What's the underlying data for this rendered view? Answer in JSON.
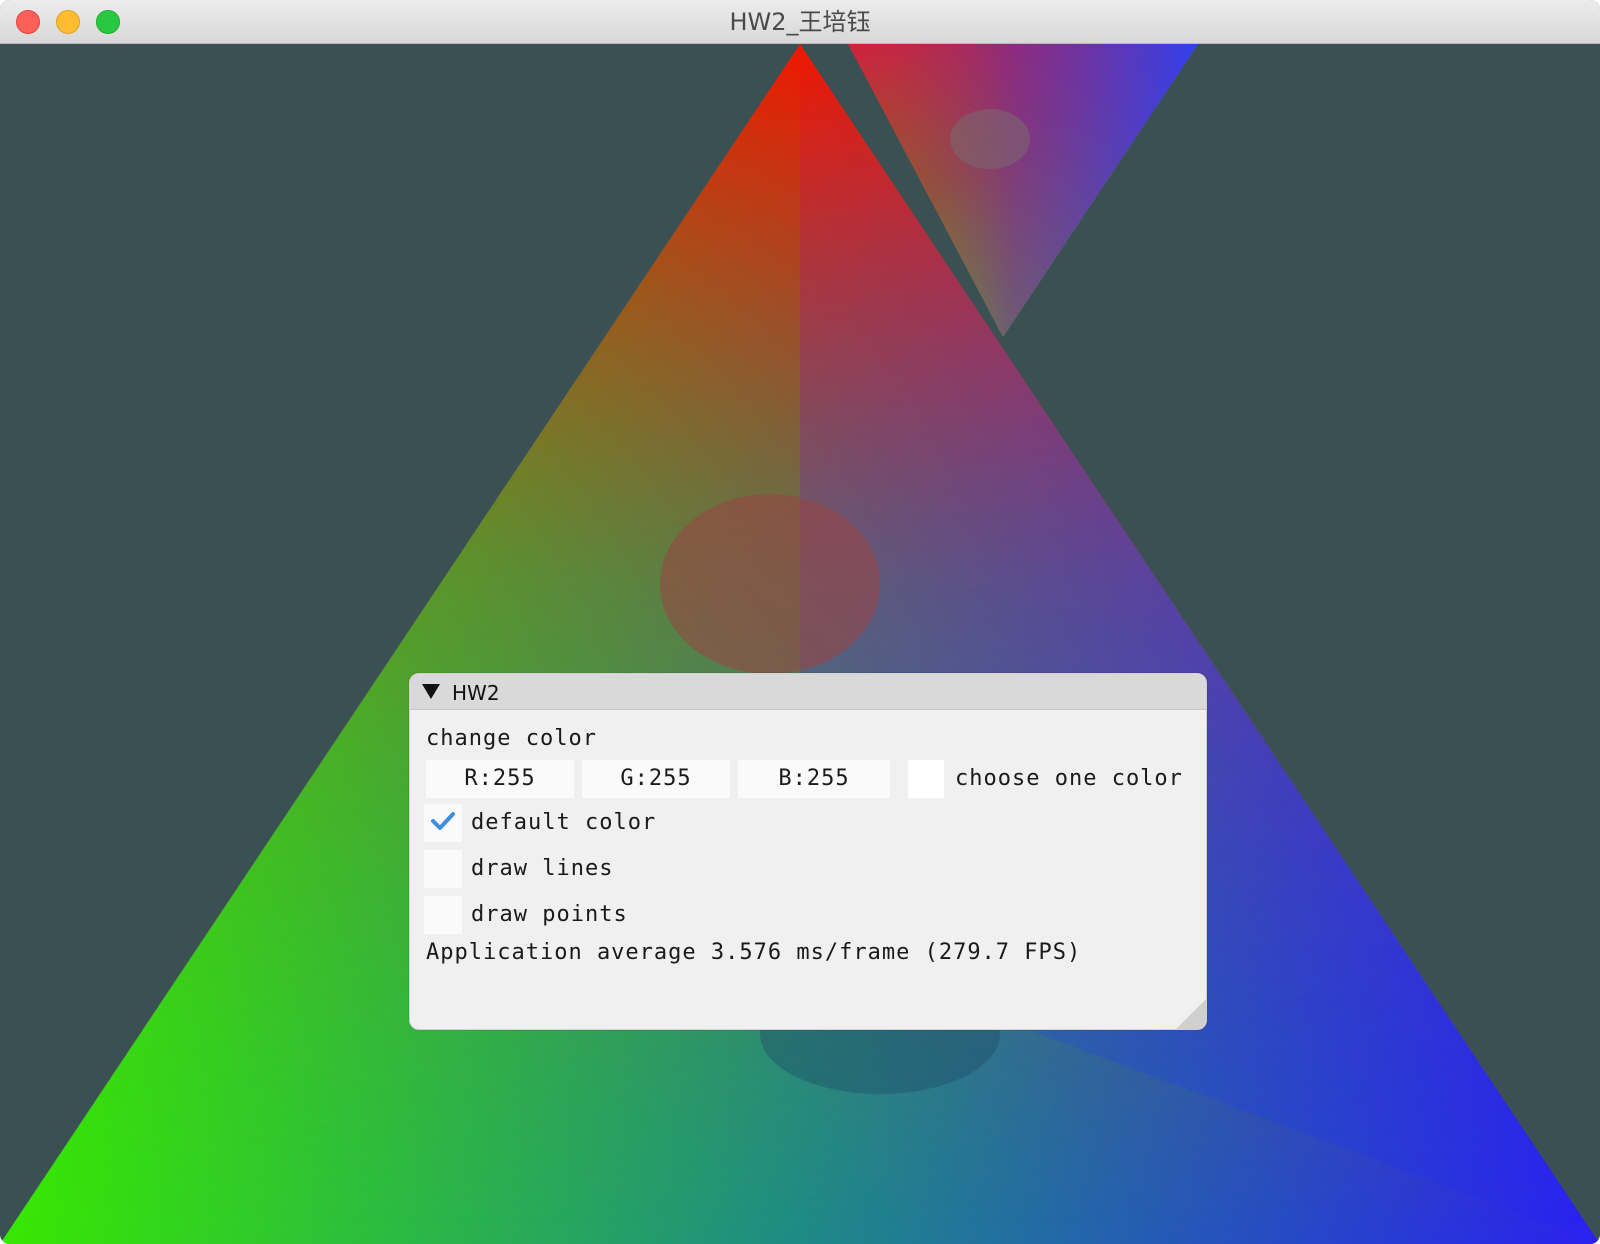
{
  "window": {
    "title": "HW2_王培钰"
  },
  "panel": {
    "title": "HW2",
    "change_color_label": "change color",
    "rgb": {
      "r_field": "R:255",
      "g_field": "G:255",
      "b_field": "B:255"
    },
    "swatch_color": "#ffffff",
    "choose_color_label": "choose one color",
    "options": [
      {
        "label": "default color",
        "checked": true
      },
      {
        "label": "draw lines",
        "checked": false
      },
      {
        "label": "draw points",
        "checked": false
      }
    ],
    "stats_text": "Application average 3.576 ms/frame (279.7 FPS)"
  },
  "colors": {
    "background": "#3a5052",
    "triangle_corners": [
      "#ff0000",
      "#00ff00",
      "#0000ff"
    ],
    "check_accent": "#3d8ee0"
  }
}
